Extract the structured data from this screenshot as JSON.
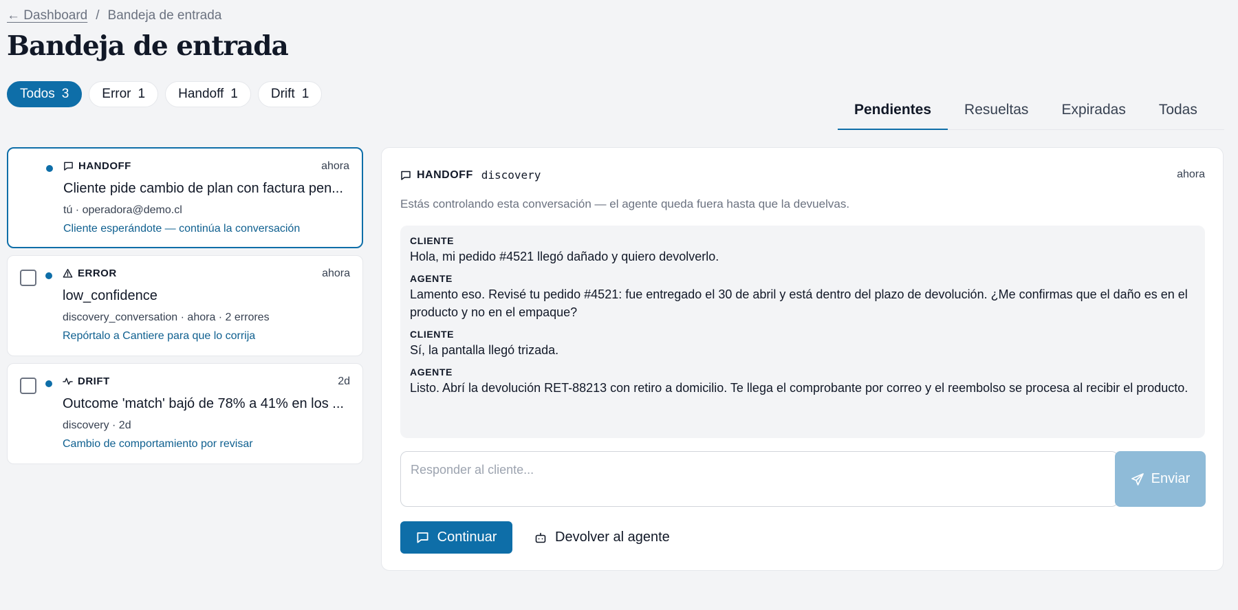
{
  "breadcrumb": {
    "back": "← Dashboard",
    "separator": "/",
    "current": "Bandeja de entrada"
  },
  "page_title": "Bandeja de entrada",
  "filters": [
    {
      "label": "Todos",
      "count": "3",
      "active": true
    },
    {
      "label": "Error",
      "count": "1"
    },
    {
      "label": "Handoff",
      "count": "1"
    },
    {
      "label": "Drift",
      "count": "1"
    }
  ],
  "tabs": [
    {
      "label": "Pendientes",
      "active": true
    },
    {
      "label": "Resueltas"
    },
    {
      "label": "Expiradas"
    },
    {
      "label": "Todas"
    }
  ],
  "items": [
    {
      "kind": "HANDOFF",
      "icon": "chat-icon",
      "time": "ahora",
      "title": "Cliente pide cambio de plan con factura pen...",
      "meta": "tú · operadora@demo.cl",
      "action": "Cliente esperándote — continúa la conversación"
    },
    {
      "kind": "ERROR",
      "icon": "warning-icon",
      "time": "ahora",
      "title": "low_confidence",
      "meta": "discovery_conversation · ahora · 2 errores",
      "action": "Repórtalo a Cantiere para que lo corrija"
    },
    {
      "kind": "DRIFT",
      "icon": "activity-icon",
      "time": "2d",
      "title": "Outcome 'match' bajó de 78% a 41% en los ...",
      "meta": "discovery · 2d",
      "action": "Cambio de comportamiento por revisar"
    }
  ],
  "detail": {
    "kind": "HANDOFF",
    "agent": "discovery",
    "time": "ahora",
    "note": "Estás controlando esta conversación — el agente queda fuera hasta que la devuelvas.",
    "messages": [
      {
        "role": "CLIENTE",
        "text": "Hola, mi pedido #4521 llegó dañado y quiero devolverlo."
      },
      {
        "role": "AGENTE",
        "text": "Lamento eso. Revisé tu pedido #4521: fue entregado el 30 de abril y está dentro del plazo de devolución. ¿Me confirmas que el daño es en el producto y no en el empaque?"
      },
      {
        "role": "CLIENTE",
        "text": "Sí, la pantalla llegó trizada."
      },
      {
        "role": "AGENTE",
        "text": "Listo. Abrí la devolución RET-88213 con retiro a domicilio. Te llega el comprobante por correo y el reembolso se procesa al recibir el producto."
      }
    ],
    "reply_placeholder": "Responder al cliente...",
    "send_label": "Enviar",
    "continue_label": "Continuar",
    "return_label": "Devolver al agente"
  },
  "colors": {
    "accent": "#0e6ea8",
    "accent_muted": "#8fbbd8",
    "link": "#0e5f8f",
    "background": "#f3f4f6"
  }
}
